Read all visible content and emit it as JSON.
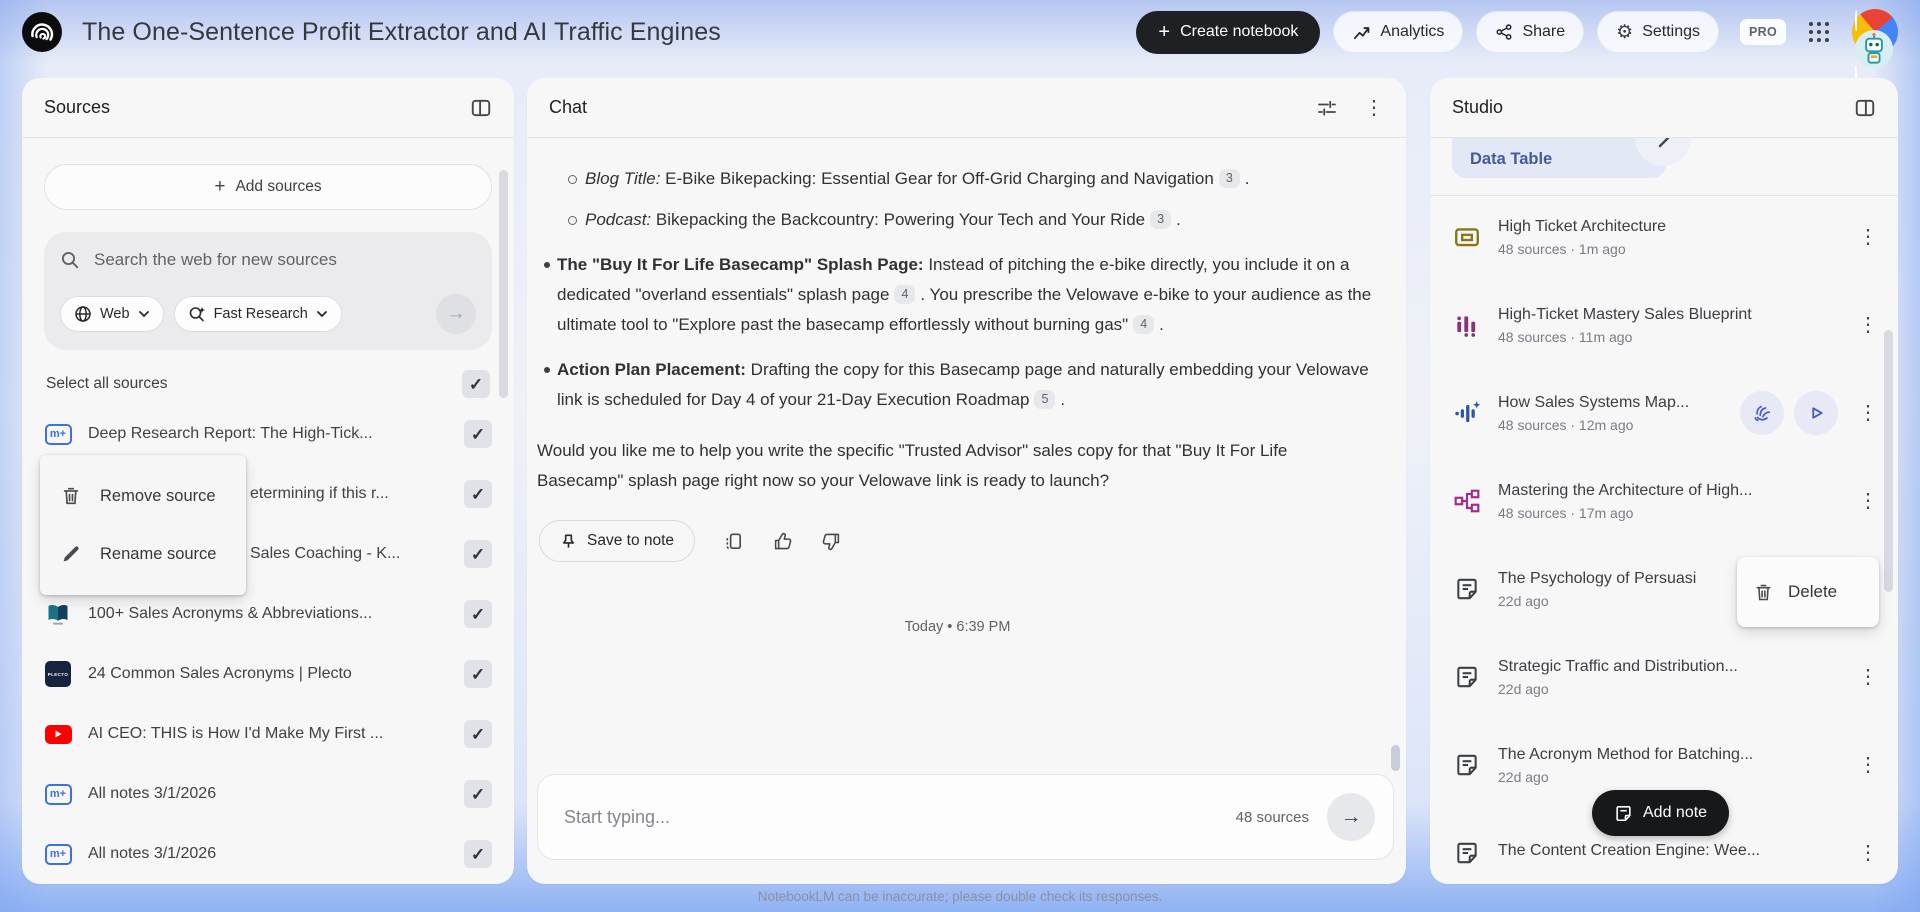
{
  "header": {
    "title": "The One-Sentence Profit Extractor and AI Traffic Engines",
    "create_notebook": "Create notebook",
    "analytics": "Analytics",
    "share": "Share",
    "settings": "Settings",
    "pro": "PRO"
  },
  "sources": {
    "title": "Sources",
    "add_sources": "Add sources",
    "search_placeholder": "Search the web for new sources",
    "web_chip": "Web",
    "research_chip": "Fast Research",
    "select_all": "Select all sources",
    "items": [
      {
        "title": "Deep Research Report: The High-Tick...",
        "icon": "markdown-note",
        "checked": true
      },
      {
        "title": "etermining if this r...",
        "icon": "hidden-behind-menu",
        "checked": true
      },
      {
        "title": "Sales Coaching - K...",
        "icon": "hidden-behind-menu",
        "checked": true
      },
      {
        "title": "100+ Sales Acronyms & Abbreviations...",
        "icon": "book-favicon",
        "checked": true
      },
      {
        "title": "24 Common Sales Acronyms | Plecto",
        "icon": "plecto-favicon",
        "checked": true
      },
      {
        "title": "AI CEO: THIS is How I'd Make My First ...",
        "icon": "youtube",
        "checked": true
      },
      {
        "title": "All notes 3/1/2026",
        "icon": "markdown-note",
        "checked": true
      },
      {
        "title": "All notes 3/1/2026",
        "icon": "markdown-note",
        "checked": true
      }
    ],
    "context_menu": {
      "remove": "Remove source",
      "rename": "Rename source"
    }
  },
  "chat": {
    "title": "Chat",
    "bullets": {
      "blog": {
        "lead": "Blog Title:",
        "text": " E-Bike Bikepacking: Essential Gear for Off-Grid Charging and Navigation",
        "citation": "3",
        "tail": "."
      },
      "podcast": {
        "lead": "Podcast:",
        "text": " Bikepacking the Backcountry: Powering Your Tech and Your Ride",
        "citation": "3",
        "tail": "."
      },
      "splash": {
        "lead": "The \"Buy It For Life Basecamp\" Splash Page:",
        "text1": " Instead of pitching the e-bike directly, you include it on a dedicated \"overland essentials\" splash page",
        "citation1": "4",
        "text2": ". You prescribe the Velowave e-bike to your audience as the ultimate tool to \"Explore past the basecamp effortlessly without burning gas\"",
        "citation2": "4",
        "tail": "."
      },
      "action": {
        "lead": "Action Plan Placement:",
        "text1": " Drafting the copy for this Basecamp page and naturally embedding your Velowave link is scheduled for Day 4 of your 21-Day Execution Roadmap",
        "citation1": "5",
        "tail": "."
      }
    },
    "closing": "Would you like me to help you write the specific \"Trusted Advisor\" sales copy for that \"Buy It For Life Basecamp\" splash page right now so your Velowave link is ready to launch?",
    "save_to_note": "Save to note",
    "timestamp": "Today • 6:39 PM",
    "input_placeholder": "Start typing...",
    "source_count": "48 sources",
    "disclaimer": "NotebookLM can be inaccurate; please double check its responses."
  },
  "studio": {
    "title": "Studio",
    "chip": "Data Table",
    "items": [
      {
        "title": "High Ticket Architecture",
        "meta": "48 sources · 1m ago",
        "icon": "flashcards"
      },
      {
        "title": "High-Ticket Mastery Sales Blueprint",
        "meta": "48 sources · 11m ago",
        "icon": "bar-chart-report"
      },
      {
        "title": "How Sales Systems Map...",
        "meta": "48 sources · 12m ago",
        "icon": "audio-overview",
        "actions": [
          "interactive-mode",
          "play"
        ]
      },
      {
        "title": "Mastering the Architecture of High...",
        "meta": "48 sources · 17m ago",
        "icon": "mind-map"
      },
      {
        "title": "The Psychology of Persuasi",
        "meta": "22d ago",
        "icon": "note"
      },
      {
        "title": "Strategic Traffic and Distribution...",
        "meta": "22d ago",
        "icon": "note"
      },
      {
        "title": "The Acronym Method for Batching...",
        "meta": "22d ago",
        "icon": "note"
      },
      {
        "title": "The Content Creation Engine: Wee...",
        "meta": "",
        "icon": "note"
      }
    ],
    "delete_menu": "Delete",
    "add_note": "Add note"
  },
  "colors": {
    "brand_black": "#1f2023",
    "source_icon_blue": "#3f6fe0",
    "youtube_red": "#ff0000",
    "studio_olive": "#8a7616",
    "studio_purple": "#8c3175",
    "studio_audio_blue": "#2c55a8",
    "studio_magenta": "#a02c8c",
    "action_indigo": "#4a5bd6",
    "chip_blue_text": "#44599e"
  }
}
